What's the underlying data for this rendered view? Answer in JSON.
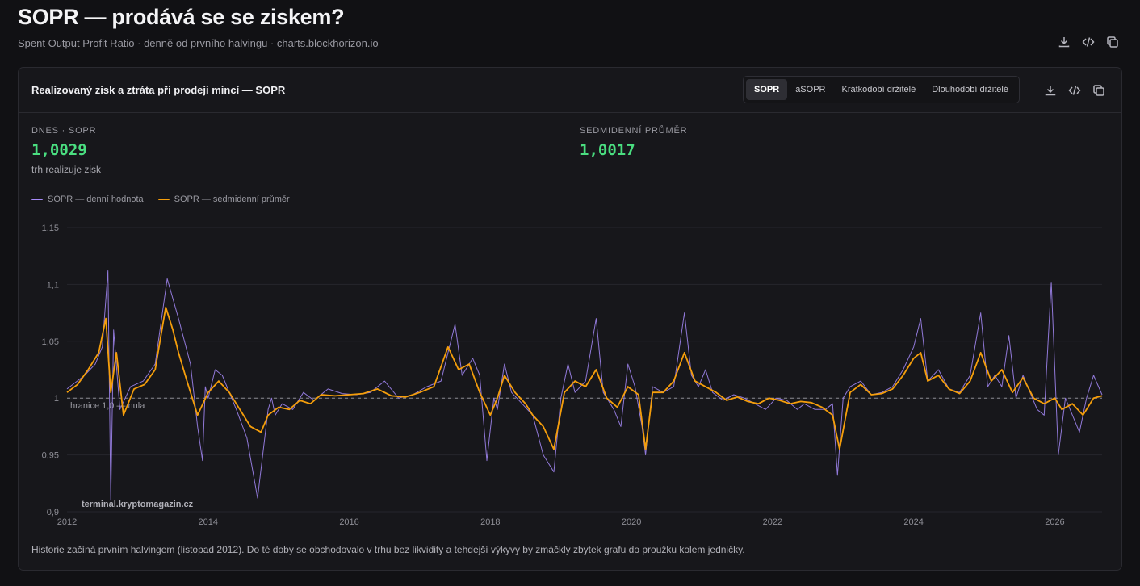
{
  "page": {
    "title": "SOPR — prodává se se ziskem?",
    "subtitle": "Spent Output Profit Ratio · denně od prvního halvingu · charts.blockhorizon.io"
  },
  "card": {
    "title": "Realizovaný zisk a ztráta při prodeji mincí — SOPR",
    "tabs": [
      {
        "label": "SOPR",
        "active": true
      },
      {
        "label": "aSOPR",
        "active": false
      },
      {
        "label": "Krátkodobí držitelé",
        "active": false
      },
      {
        "label": "Dlouhodobí držitelé",
        "active": false
      }
    ],
    "icons": [
      "download-icon",
      "code-icon",
      "copy-icon"
    ]
  },
  "stats": {
    "today": {
      "label": "DNES · SOPR",
      "value": "1,0029",
      "note": "trh realizuje zisk"
    },
    "week": {
      "label": "SEDMIDENNÍ PRŮMĚR",
      "value": "1,0017"
    }
  },
  "colors": {
    "daily": "#a78bfa",
    "avg": "#f59e0b",
    "positive": "#4ade80"
  },
  "chart_data": {
    "type": "line",
    "ylim": [
      0.9,
      1.15
    ],
    "xlim": [
      2012.0,
      2026.67
    ],
    "y_ticks": [
      "0,9",
      "0,95",
      "1",
      "1,05",
      "1,1",
      "1,15"
    ],
    "x_ticks": [
      "2012",
      "2014",
      "2016",
      "2018",
      "2020",
      "2022",
      "2024",
      "2026"
    ],
    "grid": true,
    "legend": "top-left",
    "baseline": {
      "y": 1.0,
      "label": "hranice 1,0 — nula"
    },
    "watermark": "terminal.kryptomagazin.cz",
    "series": [
      {
        "name": "SOPR — denní hodnota",
        "x": [
          2012.0,
          2012.25,
          2012.4,
          2012.5,
          2012.58,
          2012.62,
          2012.66,
          2012.75,
          2012.9,
          2013.08,
          2013.25,
          2013.42,
          2013.58,
          2013.75,
          2013.85,
          2013.92,
          2013.96,
          2014.0,
          2014.1,
          2014.2,
          2014.3,
          2014.4,
          2014.55,
          2014.7,
          2014.85,
          2014.9,
          2014.95,
          2015.05,
          2015.2,
          2015.35,
          2015.5,
          2015.7,
          2015.9,
          2016.1,
          2016.3,
          2016.5,
          2016.7,
          2016.9,
          2017.1,
          2017.3,
          2017.5,
          2017.6,
          2017.75,
          2017.85,
          2017.95,
          2018.05,
          2018.1,
          2018.2,
          2018.3,
          2018.45,
          2018.6,
          2018.75,
          2018.9,
          2019.0,
          2019.1,
          2019.2,
          2019.35,
          2019.5,
          2019.6,
          2019.75,
          2019.85,
          2019.95,
          2020.05,
          2020.15,
          2020.2,
          2020.3,
          2020.45,
          2020.6,
          2020.75,
          2020.85,
          2020.95,
          2021.05,
          2021.15,
          2021.3,
          2021.45,
          2021.6,
          2021.75,
          2021.9,
          2022.05,
          2022.2,
          2022.35,
          2022.45,
          2022.6,
          2022.75,
          2022.85,
          2022.92,
          2023.0,
          2023.1,
          2023.25,
          2023.4,
          2023.55,
          2023.7,
          2023.85,
          2024.0,
          2024.1,
          2024.2,
          2024.35,
          2024.5,
          2024.65,
          2024.8,
          2024.95,
          2025.05,
          2025.15,
          2025.25,
          2025.35,
          2025.45,
          2025.55,
          2025.65,
          2025.75,
          2025.85,
          2025.95,
          2026.05,
          2026.15,
          2026.25,
          2026.35,
          2026.45,
          2026.55,
          2026.67
        ],
        "y": [
          1.008,
          1.02,
          1.03,
          1.045,
          1.112,
          0.91,
          1.06,
          0.99,
          1.01,
          1.015,
          1.03,
          1.105,
          1.07,
          1.03,
          0.975,
          0.945,
          1.01,
          1.0,
          1.025,
          1.02,
          1.005,
          0.99,
          0.965,
          0.912,
          0.99,
          1.0,
          0.985,
          0.995,
          0.99,
          1.005,
          0.998,
          1.008,
          1.004,
          1.003,
          1.005,
          1.015,
          1.0,
          1.003,
          1.01,
          1.015,
          1.065,
          1.02,
          1.035,
          1.02,
          0.945,
          1.0,
          0.99,
          1.03,
          1.005,
          0.995,
          0.985,
          0.95,
          0.935,
          1.0,
          1.03,
          1.005,
          1.015,
          1.07,
          1.005,
          0.99,
          0.975,
          1.03,
          1.01,
          0.975,
          0.95,
          1.01,
          1.005,
          1.01,
          1.075,
          1.02,
          1.01,
          1.025,
          1.005,
          0.998,
          1.003,
          1.0,
          0.995,
          0.99,
          1.0,
          0.998,
          0.99,
          0.995,
          0.99,
          0.99,
          0.995,
          0.932,
          1.0,
          1.01,
          1.015,
          1.003,
          1.005,
          1.01,
          1.025,
          1.045,
          1.07,
          1.015,
          1.025,
          1.008,
          1.005,
          1.02,
          1.075,
          1.01,
          1.02,
          1.01,
          1.055,
          1.0,
          1.02,
          1.005,
          0.99,
          0.985,
          1.102,
          0.95,
          1.0,
          0.985,
          0.97,
          1.0,
          1.02,
          1.003
        ]
      },
      {
        "name": "SOPR — sedmidenní průměr",
        "x": [
          2012.0,
          2012.15,
          2012.3,
          2012.45,
          2012.55,
          2012.62,
          2012.7,
          2012.8,
          2012.95,
          2013.1,
          2013.25,
          2013.4,
          2013.5,
          2013.58,
          2013.7,
          2013.85,
          2014.0,
          2014.15,
          2014.3,
          2014.45,
          2014.6,
          2014.75,
          2014.85,
          2015.0,
          2015.15,
          2015.3,
          2015.45,
          2015.6,
          2015.8,
          2016.0,
          2016.2,
          2016.4,
          2016.6,
          2016.8,
          2017.0,
          2017.2,
          2017.4,
          2017.55,
          2017.7,
          2017.85,
          2018.0,
          2018.1,
          2018.2,
          2018.35,
          2018.5,
          2018.6,
          2018.75,
          2018.9,
          2019.05,
          2019.2,
          2019.35,
          2019.5,
          2019.65,
          2019.8,
          2019.95,
          2020.1,
          2020.2,
          2020.3,
          2020.45,
          2020.6,
          2020.75,
          2020.9,
          2021.05,
          2021.2,
          2021.35,
          2021.5,
          2021.65,
          2021.8,
          2021.95,
          2022.1,
          2022.25,
          2022.4,
          2022.55,
          2022.7,
          2022.85,
          2022.95,
          2023.1,
          2023.25,
          2023.4,
          2023.55,
          2023.7,
          2023.85,
          2024.0,
          2024.1,
          2024.2,
          2024.35,
          2024.5,
          2024.65,
          2024.8,
          2024.95,
          2025.1,
          2025.25,
          2025.4,
          2025.55,
          2025.7,
          2025.85,
          2026.0,
          2026.1,
          2026.25,
          2026.4,
          2026.55,
          2026.67
        ],
        "y": [
          1.005,
          1.012,
          1.025,
          1.04,
          1.07,
          1.005,
          1.04,
          0.985,
          1.008,
          1.012,
          1.025,
          1.08,
          1.06,
          1.04,
          1.015,
          0.985,
          1.005,
          1.015,
          1.005,
          0.99,
          0.975,
          0.97,
          0.985,
          0.992,
          0.99,
          0.998,
          0.995,
          1.003,
          1.002,
          1.003,
          1.004,
          1.008,
          1.002,
          1.001,
          1.005,
          1.01,
          1.045,
          1.025,
          1.03,
          1.005,
          0.985,
          1.0,
          1.02,
          1.005,
          0.995,
          0.985,
          0.975,
          0.955,
          1.005,
          1.015,
          1.01,
          1.025,
          1.0,
          0.992,
          1.01,
          1.003,
          0.955,
          1.005,
          1.005,
          1.015,
          1.04,
          1.015,
          1.01,
          1.005,
          0.998,
          1.001,
          0.997,
          0.995,
          1.0,
          0.998,
          0.995,
          0.997,
          0.996,
          0.992,
          0.985,
          0.955,
          1.005,
          1.012,
          1.003,
          1.004,
          1.008,
          1.02,
          1.035,
          1.04,
          1.015,
          1.02,
          1.008,
          1.004,
          1.015,
          1.04,
          1.015,
          1.025,
          1.005,
          1.018,
          1.0,
          0.995,
          1.0,
          0.99,
          0.995,
          0.985,
          1.0,
          1.002
        ]
      }
    ]
  },
  "footnote": "Historie začíná prvním halvingem (listopad 2012). Do té doby se obchodovalo v trhu bez likvidity a tehdejší výkyvy by zmáčkly zbytek grafu do proužku kolem jedničky."
}
